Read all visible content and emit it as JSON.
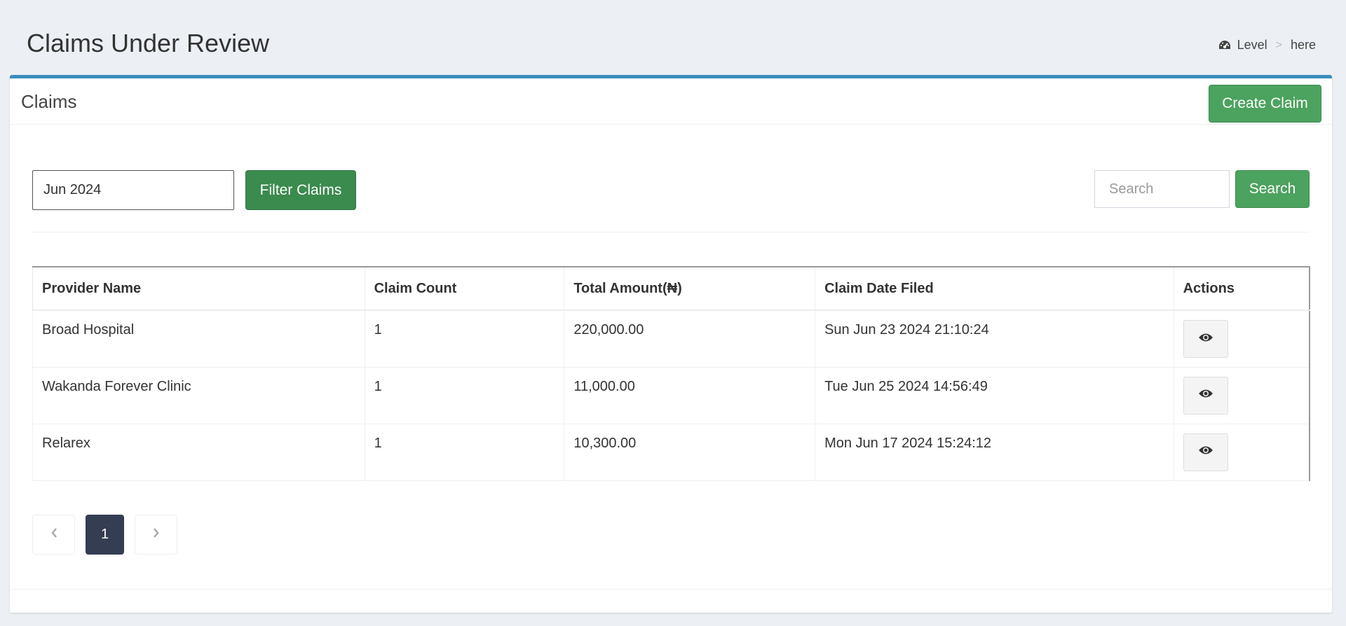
{
  "header": {
    "title": "Claims Under Review",
    "breadcrumb": {
      "icon": "dashboard-icon",
      "level": "Level",
      "separator": ">",
      "current": "here"
    }
  },
  "box": {
    "title": "Claims",
    "create_label": "Create Claim"
  },
  "filters": {
    "month_value": "Jun 2024",
    "filter_label": "Filter Claims",
    "search_placeholder": "Search",
    "search_label": "Search"
  },
  "table": {
    "columns": [
      "Provider Name",
      "Claim Count",
      "Total Amount(₦)",
      "Claim Date Filed",
      "Actions"
    ],
    "rows": [
      {
        "provider": "Broad Hospital",
        "count": "1",
        "amount": "220,000.00",
        "date": "Sun Jun 23 2024 21:10:24",
        "action_icon": "eye-icon"
      },
      {
        "provider": "Wakanda Forever Clinic",
        "count": "1",
        "amount": "11,000.00",
        "date": "Tue Jun 25 2024 14:56:49",
        "action_icon": "eye-icon"
      },
      {
        "provider": "Relarex",
        "count": "1",
        "amount": "10,300.00",
        "date": "Mon Jun 17 2024 15:24:12",
        "action_icon": "eye-icon"
      }
    ]
  },
  "pagination": {
    "prev_icon": "chevron-left-icon",
    "current_page": "1",
    "next_icon": "chevron-right-icon"
  },
  "colors": {
    "accent": "#3c8dbc",
    "success": "#4ca25f",
    "page_active": "#343d52",
    "background": "#ecf0f5"
  }
}
